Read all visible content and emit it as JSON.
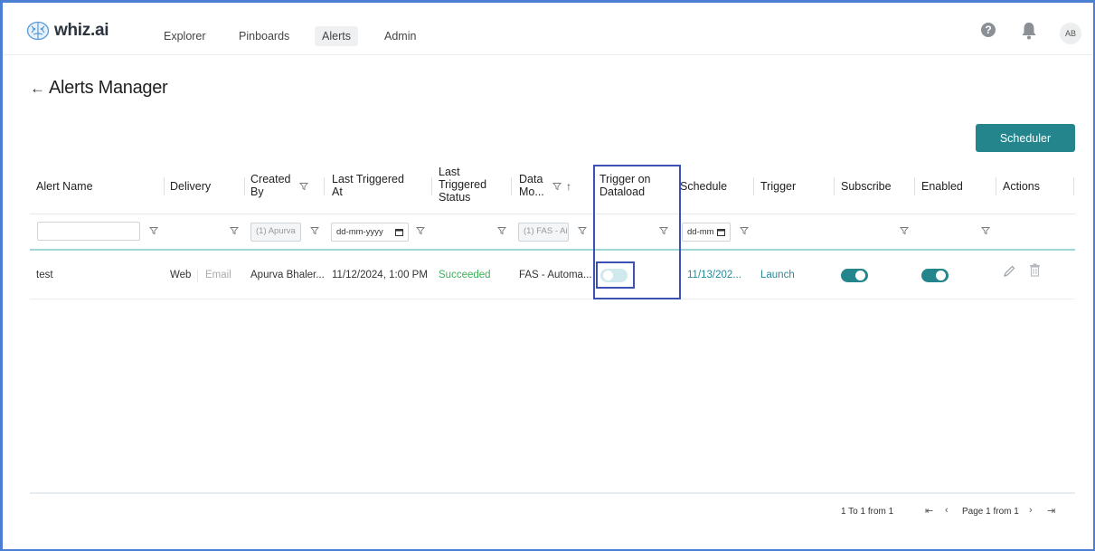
{
  "app": {
    "logo_text": "whiz.ai",
    "nav": [
      "Explorer",
      "Pinboards",
      "Alerts",
      "Admin"
    ],
    "active_nav": "Alerts",
    "avatar_initials": "AB"
  },
  "page": {
    "title": "Alerts Manager",
    "scheduler_label": "Scheduler"
  },
  "table": {
    "headers": {
      "alert_name": "Alert Name",
      "delivery": "Delivery",
      "created_by_1": "Created",
      "created_by_2": "By",
      "last_triggered_at_1": "Last Triggered",
      "last_triggered_at_2": "At",
      "last_status_1": "Last",
      "last_status_2": "Triggered",
      "last_status_3": "Status",
      "data_model_1": "Data",
      "data_model_2": "Mo...",
      "trigger_on_dataload_1": "Trigger on",
      "trigger_on_dataload_2": "Dataload",
      "schedule": "Schedule",
      "trigger": "Trigger",
      "subscribe": "Subscribe",
      "enabled": "Enabled",
      "actions": "Actions"
    },
    "filters": {
      "alert_name_value": "",
      "created_by_value": "(1) Apurva",
      "last_triggered_placeholder": "dd-mm-yyyy",
      "data_model_value": "(1) FAS - Ai",
      "schedule_placeholder": "dd-mm"
    },
    "rows": [
      {
        "alert_name": "test",
        "delivery_web": "Web",
        "delivery_email": "Email",
        "created_by": "Apurva Bhaler...",
        "last_triggered_at": "11/12/2024, 1:00 PM",
        "status": "Succeeded",
        "data_model": "FAS - Automa...",
        "trigger_on_dataload": false,
        "schedule": "11/13/202...",
        "trigger": "Launch",
        "subscribe": true,
        "enabled": true
      }
    ]
  },
  "pagination": {
    "summary": "1 To 1 from 1",
    "page_label": "Page 1 from 1"
  },
  "colors": {
    "accent": "#24868c",
    "success": "#3bb15a",
    "link": "#2a8a99",
    "highlight": "#3b52b4"
  }
}
